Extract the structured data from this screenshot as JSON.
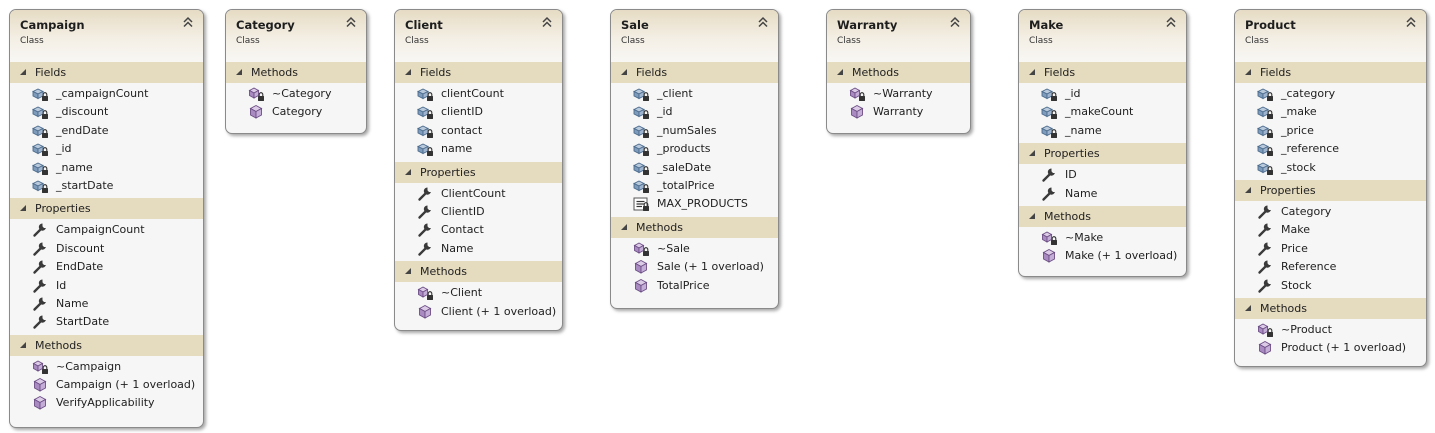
{
  "stereotype": "Class",
  "sections": {
    "fields": "Fields",
    "properties": "Properties",
    "methods": "Methods"
  },
  "classes": [
    {
      "name": "Campaign",
      "fields": [
        "_campaignCount",
        "_discount",
        "_endDate",
        "_id",
        "_name",
        "_startDate"
      ],
      "properties": [
        "CampaignCount",
        "Discount",
        "EndDate",
        "Id",
        "Name",
        "StartDate"
      ],
      "methods": [
        {
          "label": "~Campaign",
          "icon": "private-method-icon"
        },
        {
          "label": "Campaign (+ 1 overload)",
          "icon": "method-icon"
        },
        {
          "label": "VerifyApplicability",
          "icon": "method-icon"
        }
      ]
    },
    {
      "name": "Category",
      "methods": [
        {
          "label": "~Category",
          "icon": "private-method-icon"
        },
        {
          "label": "Category",
          "icon": "method-icon"
        }
      ]
    },
    {
      "name": "Client",
      "fields": [
        "clientCount",
        "clientID",
        "contact",
        "name"
      ],
      "properties": [
        "ClientCount",
        "ClientID",
        "Contact",
        "Name"
      ],
      "methods": [
        {
          "label": "~Client",
          "icon": "private-method-icon"
        },
        {
          "label": "Client (+ 1 overload)",
          "icon": "method-icon"
        }
      ]
    },
    {
      "name": "Sale",
      "fields": [
        "_client",
        "_id",
        "_numSales",
        "_products",
        "_saleDate",
        "_totalPrice",
        {
          "label": "MAX_PRODUCTS",
          "icon": "constant-icon"
        }
      ],
      "methods": [
        {
          "label": "~Sale",
          "icon": "private-method-icon"
        },
        {
          "label": "Sale (+ 1 overload)",
          "icon": "method-icon"
        },
        {
          "label": "TotalPrice",
          "icon": "method-icon"
        }
      ]
    },
    {
      "name": "Warranty",
      "methods": [
        {
          "label": "~Warranty",
          "icon": "private-method-icon"
        },
        {
          "label": "Warranty",
          "icon": "method-icon"
        }
      ]
    },
    {
      "name": "Make",
      "fields": [
        "_id",
        "_makeCount",
        "_name"
      ],
      "properties": [
        "ID",
        "Name"
      ],
      "methods": [
        {
          "label": "~Make",
          "icon": "private-method-icon"
        },
        {
          "label": "Make (+ 1 overload)",
          "icon": "method-icon"
        }
      ]
    },
    {
      "name": "Product",
      "fields": [
        "_category",
        "_make",
        "_price",
        "_reference",
        "_stock"
      ],
      "properties": [
        "Category",
        "Make",
        "Price",
        "Reference",
        "Stock"
      ],
      "methods": [
        {
          "label": "~Product",
          "icon": "private-method-icon"
        },
        {
          "label": "Product (+ 1 overload)",
          "icon": "method-icon"
        }
      ]
    }
  ]
}
